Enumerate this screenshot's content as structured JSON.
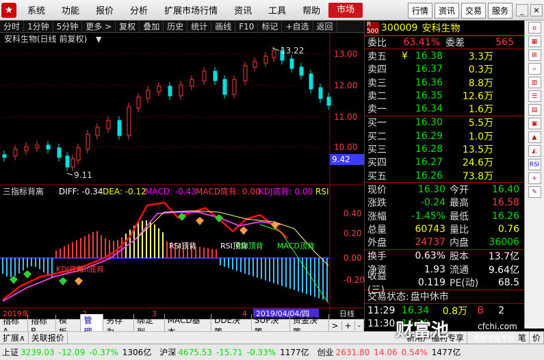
{
  "menubar": {
    "items": [
      "系统",
      "功能",
      "报价",
      "分析",
      "扩展市场行情",
      "资讯",
      "工具",
      "帮助",
      "市场"
    ],
    "right_buttons": [
      "行情",
      "资讯",
      "交易",
      "服务"
    ]
  },
  "toolbar": {
    "items": [
      "分时",
      "1分钟",
      "5分钟",
      "更多 >",
      "复权",
      "叠加",
      "历史",
      "统计",
      "画线",
      "F10",
      "标记",
      "+自选",
      "返回"
    ]
  },
  "kline": {
    "title": "安科生物(日线 前复权)",
    "price_ticks": [
      "13.00",
      "12.00",
      "11.00",
      "10.00"
    ],
    "high_mark": "13.22",
    "low_mark": "9.11",
    "current_price_tag": "9.42"
  },
  "indicator": {
    "name": "三指标背离",
    "diff": "DIFF: -0.34",
    "dea": "DEA: -0.12",
    "macd": "MACD: -0.43",
    "macd_div": "MACD底背: 0.00",
    "kdj_div": "KDJ底背: 0.00",
    "rsi": "RSI",
    "ticks": [
      "0.40",
      "0.20",
      "0.00",
      "-0.20"
    ],
    "labels": [
      "KDJ底背",
      "RSI底背",
      "RSI顶背",
      "RSI顶背",
      "RSI顶背",
      "MACD顶背"
    ],
    "date_left": "2019年",
    "date_ticks": [
      "2",
      "3",
      "4"
    ],
    "date_highlight": "2019/04/04/四",
    "period": "日线"
  },
  "quote": {
    "badge": "R 500",
    "code": "300009",
    "name": "安科生物",
    "weibi_label": "委比",
    "weibi": "63.41%",
    "weicha_label": "委差",
    "weicha": "565",
    "sells": [
      {
        "label": "卖五",
        "mark": "¥",
        "price": "16.38",
        "vol": "3.3万"
      },
      {
        "label": "卖四",
        "mark": "",
        "price": "16.37",
        "vol": "0.3万"
      },
      {
        "label": "卖三",
        "mark": "",
        "price": "16.36",
        "vol": "8.8万"
      },
      {
        "label": "卖二",
        "mark": "",
        "price": "16.35",
        "vol": "12.6万"
      },
      {
        "label": "卖一",
        "mark": "",
        "price": "16.34",
        "vol": "1.6万"
      }
    ],
    "buys": [
      {
        "label": "买一",
        "price": "16.30",
        "vol": "5.5万"
      },
      {
        "label": "买二",
        "price": "16.29",
        "vol": "1.0万"
      },
      {
        "label": "买三",
        "price": "16.28",
        "vol": "13.5万"
      },
      {
        "label": "买四",
        "price": "16.27",
        "vol": "24.6万"
      },
      {
        "label": "买五",
        "price": "16.26",
        "vol": "73.8万"
      }
    ],
    "stats": [
      {
        "l1": "现价",
        "v1": "16.30",
        "l2": "今开",
        "v2": "16.40"
      },
      {
        "l1": "涨跌",
        "v1": "-0.24",
        "l2": "最高",
        "v2": "16.58"
      },
      {
        "l1": "涨幅",
        "v1": "-1.45%",
        "l2": "最低",
        "v2": "16.26"
      },
      {
        "l1": "总量",
        "v1": "60743",
        "l2": "量比",
        "v2": "0.76"
      },
      {
        "l1": "外盘",
        "v1": "24737",
        "l2": "内盘",
        "v2": "36006"
      }
    ],
    "stats2": [
      {
        "l1": "换手",
        "v1": "0.63%",
        "l2": "股本",
        "v2": "13.7亿"
      },
      {
        "l1": "净资",
        "v1": "1.93",
        "l2": "流通",
        "v2": "9.64亿"
      },
      {
        "l1": "收益(三)",
        "v1": "0.119",
        "l2": "PE(动)",
        "v2": "68.5"
      }
    ],
    "trade_status_label": "交易状态:",
    "trade_status": "盘中休市",
    "ticks": [
      {
        "time": "11:29",
        "price": "16.34",
        "vol": "0.8万",
        "flag": "B",
        "num": "2"
      },
      {
        "time": "11:30",
        "price": "16.30",
        "vol": "",
        "flag": "",
        "num": ""
      }
    ]
  },
  "bottom_tabs": [
    "指标A",
    "指标B",
    "模 板",
    "管理",
    "另存为",
    "绑定到",
    "MACD基本",
    "DDE决策",
    "SUP决策",
    "资金决策"
  ],
  "row2": {
    "left": [
      "扩展∧",
      "关联报价"
    ],
    "right": [
      "新用户福利专享",
      "笔",
      "价"
    ]
  },
  "statusbar": {
    "items": [
      {
        "label": "上证",
        "value": "3239.03",
        "chg": "-12.09",
        "pct": "-0.37%",
        "amt": "1306亿"
      },
      {
        "label": "沪深",
        "value": "4675.53",
        "chg": "-15.71",
        "pct": "-0.33%",
        "amt": "1177亿"
      },
      {
        "label": "创业",
        "value": "2631.80",
        "chg": "14.06",
        "pct": "0.54%",
        "amt": "1477亿"
      }
    ]
  },
  "watermark": {
    "brand": "财富池",
    "url": "cfchi.com",
    "sub": "指标交易平台"
  },
  "sidebar_icons": [
    "home-icon",
    "calendar-icon",
    "grid-icon",
    "search-icon",
    "bars-icon",
    "list-icon",
    "report-icon",
    "news-icon",
    "chart-icon",
    "chart-icon",
    "rsi-icon",
    "plus-icon",
    "pen-icon"
  ],
  "colors": {
    "up": "#ff3b3b",
    "down": "#00e0e0",
    "bg": "#000000",
    "axis": "#a00000"
  }
}
